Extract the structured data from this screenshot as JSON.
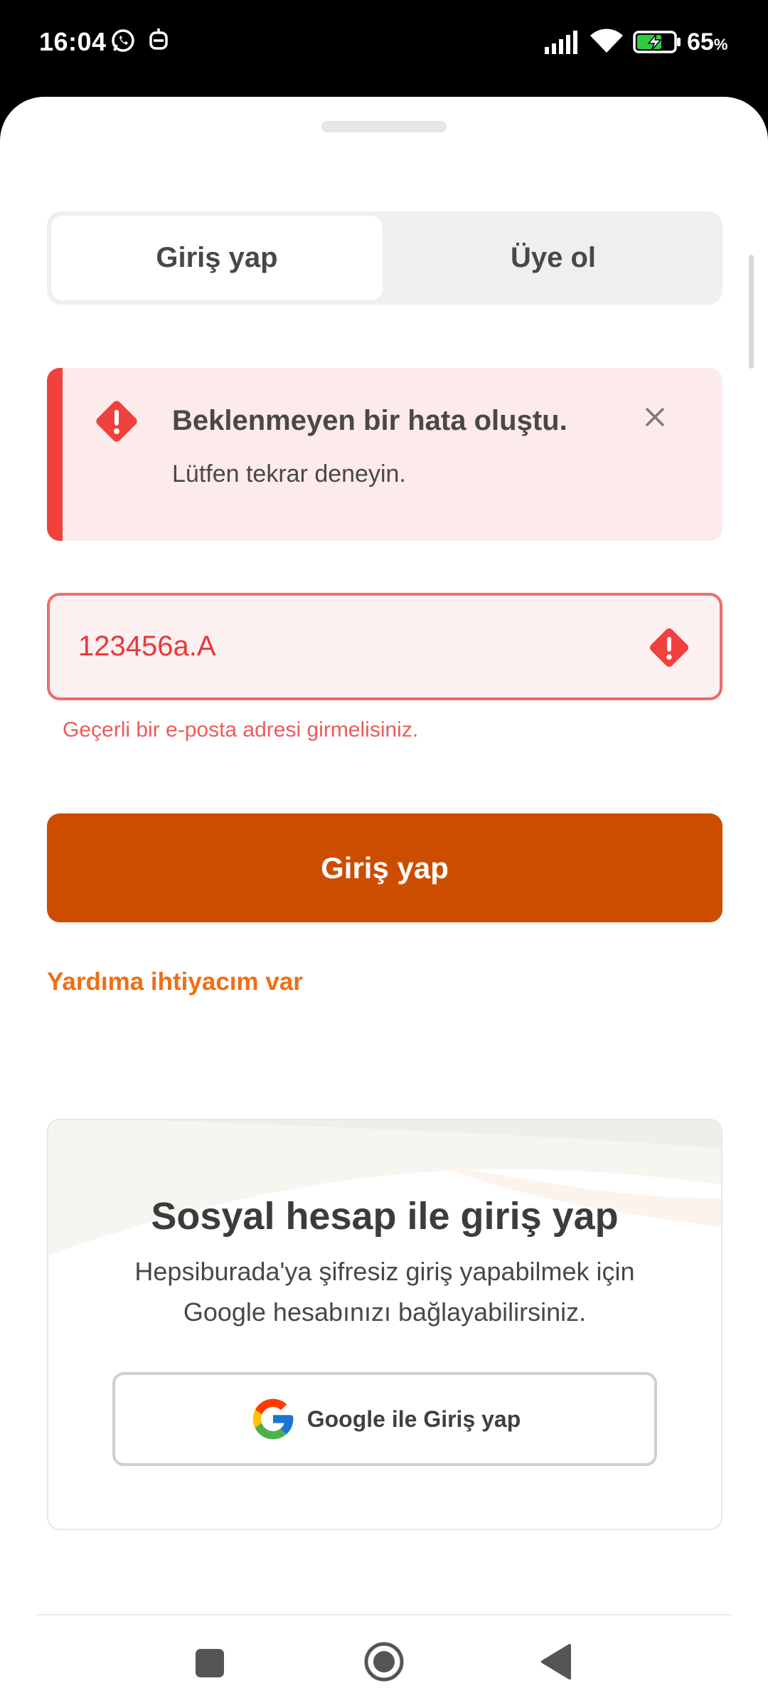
{
  "status_bar": {
    "time": "16:04",
    "battery": "65",
    "battery_unit": "%",
    "icons": [
      "whatsapp-icon",
      "robot-icon",
      "signal-icon",
      "wifi-icon",
      "battery-charging-icon"
    ]
  },
  "tabs": {
    "login": "Giriş yap",
    "register": "Üye ol",
    "active": "login"
  },
  "alert": {
    "title": "Beklenmeyen bir hata oluştu.",
    "message": "Lütfen tekrar deneyin.",
    "icon": "error-diamond-icon",
    "close_icon": "close-icon"
  },
  "email_input": {
    "value": "123456a.A",
    "error": "Geçerli bir e-posta adresi girmelisiniz.",
    "icon": "error-diamond-icon"
  },
  "login_button": "Giriş yap",
  "help_link": "Yardıma ihtiyacım var",
  "social": {
    "title": "Sosyal hesap ile giriş yap",
    "description": "Hepsiburada'ya şifresiz giriş yapabilmek için Google hesabınızı bağlayabilirsiniz.",
    "google_button": "Google ile Giriş yap",
    "google_icon": "google-icon"
  },
  "colors": {
    "primary": "#cc4d00",
    "link": "#f06e14",
    "error": "#f0413d",
    "error_bg": "#fdeaea"
  },
  "nav": [
    "recents-icon",
    "home-icon",
    "back-icon"
  ]
}
